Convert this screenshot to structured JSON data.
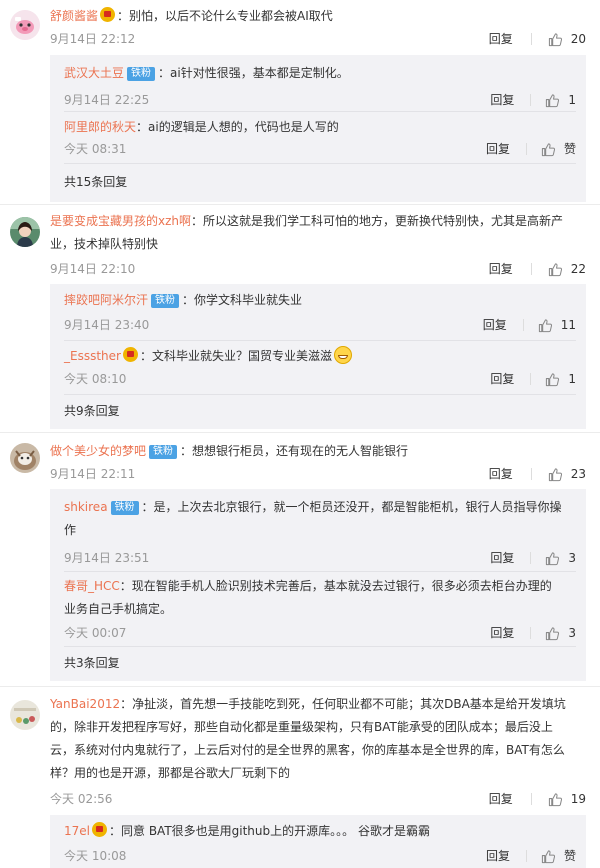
{
  "comments": [
    {
      "user": "舒颜酱酱",
      "text": "：别怕，以后不论什么专业都会被AI取代",
      "time": "9月14日 22:12",
      "reply_label": "回复",
      "likes": "20",
      "replies": [
        {
          "user": "武汉大土豆",
          "badge": "铁粉",
          "text": "：ai针对性很强，基本都是定制化。",
          "time": "9月14日 22:25",
          "reply_label": "回复",
          "likes": "1"
        },
        {
          "user": "阿里郎的秋天",
          "text": "：ai的逻辑是人想的，代码也是人写的",
          "time": "今天 08:31",
          "reply_label": "回复",
          "likes": "赞"
        }
      ],
      "more": "共15条回复"
    },
    {
      "user": "是要变成宝藏男孩的xzh啊",
      "text_line1": "：所以这就是我们学工科可怕的地方，更新换代特别快，尤其是高新产",
      "text_line2": "业，技术掉队特别快",
      "time": "9月14日 22:10",
      "reply_label": "回复",
      "likes": "22",
      "replies": [
        {
          "user": "摔跤吧阿米尔汗",
          "badge": "铁粉",
          "text": "：你学文科毕业就失业",
          "time": "9月14日 23:40",
          "reply_label": "回复",
          "likes": "11"
        },
        {
          "user": "_Esssther",
          "text": "：文科毕业就失业？国贸专业美滋滋",
          "time": "今天 08:10",
          "reply_label": "回复",
          "likes": "1"
        }
      ],
      "more": "共9条回复"
    },
    {
      "user": "做个美少女的梦吧",
      "badge": "铁粉",
      "text": "：想想银行柜员，还有现在的无人智能银行",
      "time": "9月14日 22:11",
      "reply_label": "回复",
      "likes": "23",
      "replies": [
        {
          "user": "shkirea",
          "badge": "铁粉",
          "text_line1": "：是，上次去北京银行，就一个柜员还没开，都是智能柜机，银行人员指导你操",
          "text_line2": "作",
          "time": "9月14日 23:51",
          "reply_label": "回复",
          "likes": "3"
        },
        {
          "user": "春哥_HCC",
          "text_line1": "：现在智能手机人脸识别技术完善后，基本就没去过银行，很多必须去柜台办理的",
          "text_line2": "业务自己手机搞定。",
          "time": "今天 00:07",
          "reply_label": "回复",
          "likes": "3"
        }
      ],
      "more": "共3条回复"
    },
    {
      "user": "YanBai2012",
      "text_line1": "：净扯淡，首先想一手技能吃到死，任何职业都不可能；其次DBA基本是给开发填坑",
      "text_line2": "的，除非开发把程序写好，那些自动化都是重量级架构，只有BAT能承受的团队成本；最后没上",
      "text_line3": "云，系统对付内鬼就行了，上云后对付的是全世界的黑客，你的库基本是全世界的库，BAT有怎么",
      "text_line4": "样？用的也是开源，那都是谷歌大厂玩剩下的",
      "time": "今天 02:56",
      "reply_label": "回复",
      "likes": "19",
      "replies": [
        {
          "user": "17el",
          "text": "：同意 BAT很多也是用github上的开源库。。。 谷歌才是霸霸",
          "time": "今天 10:08",
          "reply_label": "回复",
          "likes": "赞"
        }
      ]
    }
  ],
  "colors": {
    "username": "#eb7350",
    "badge": "#4ba2e4",
    "reply_bg": "#f2f2f5",
    "meta": "#999999"
  },
  "icons": {
    "like": "thumbs-up-icon",
    "vip": "vip-badge-icon",
    "emoji": "grin-emoji-icon"
  }
}
